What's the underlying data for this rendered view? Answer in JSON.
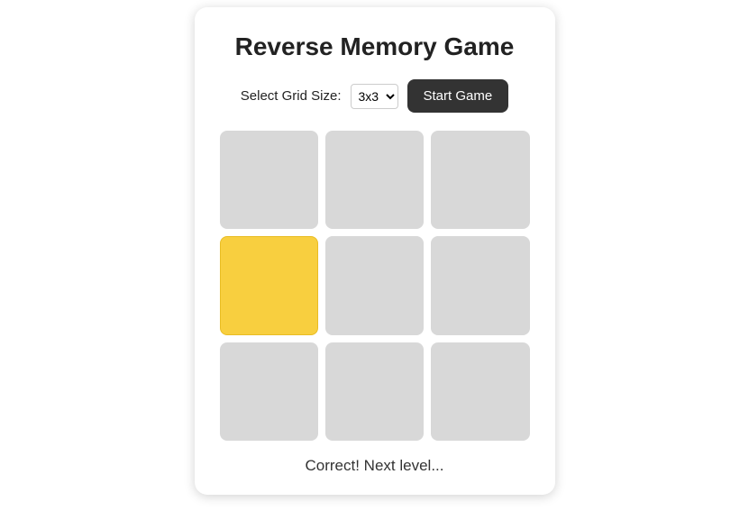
{
  "title": "Reverse Memory Game",
  "controls": {
    "select_label": "Select Grid Size:",
    "selected_option": "3x3",
    "start_label": "Start Game"
  },
  "grid": {
    "size": 3,
    "cells": [
      {
        "state": "idle"
      },
      {
        "state": "idle"
      },
      {
        "state": "idle"
      },
      {
        "state": "correct"
      },
      {
        "state": "idle"
      },
      {
        "state": "idle"
      },
      {
        "state": "idle"
      },
      {
        "state": "idle"
      },
      {
        "state": "idle"
      }
    ]
  },
  "status_text": "Correct! Next level...",
  "colors": {
    "correct_cell": "#f8cf3f",
    "idle_cell": "#d8d8d8",
    "button_bg": "#333333",
    "button_fg": "#ffffff"
  }
}
